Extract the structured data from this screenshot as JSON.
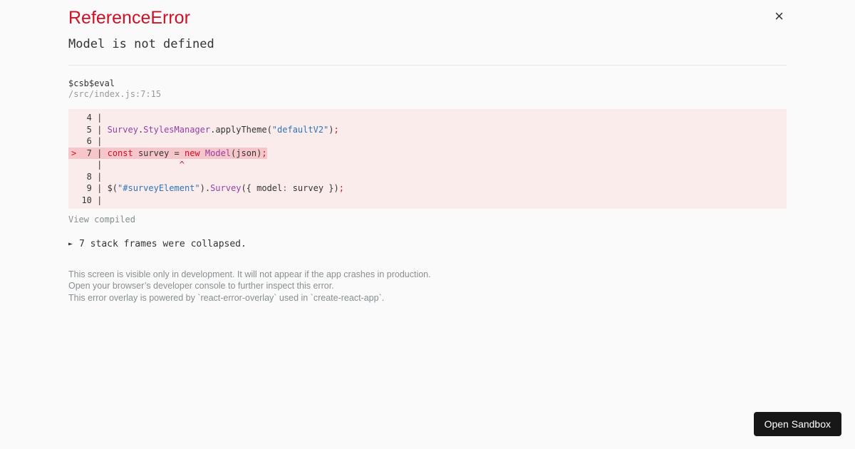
{
  "header": {
    "title": "ReferenceError",
    "subtitle": "Model is not defined",
    "close_icon": "×"
  },
  "frame": {
    "function_name": "$csb$eval",
    "location": "/src/index.js:7:15",
    "view_toggle": "View compiled"
  },
  "code_frame": {
    "background": "#fbecec",
    "highlight_background": "#f6c6cb",
    "palette": {
      "plain": "#333333",
      "red": "#ce1126",
      "class": "#9440a4",
      "string": "#2d74b8"
    },
    "lines": [
      {
        "highlight": false,
        "tokens": [
          {
            "t": "   4 | ",
            "c": "plain"
          }
        ]
      },
      {
        "highlight": false,
        "tokens": [
          {
            "t": "   5 | ",
            "c": "plain"
          },
          {
            "t": "Survey",
            "c": "class"
          },
          {
            "t": ".",
            "c": "plain"
          },
          {
            "t": "StylesManager",
            "c": "class"
          },
          {
            "t": ".applyTheme(",
            "c": "plain"
          },
          {
            "t": "\"defaultV2\"",
            "c": "string"
          },
          {
            "t": ")",
            "c": "plain"
          },
          {
            "t": ";",
            "c": "red"
          }
        ]
      },
      {
        "highlight": false,
        "tokens": [
          {
            "t": "   6 | ",
            "c": "plain"
          }
        ]
      },
      {
        "highlight": true,
        "tokens": [
          {
            "t": ">",
            "c": "red"
          },
          {
            "t": "  7 | ",
            "c": "plain"
          },
          {
            "t": "const",
            "c": "red"
          },
          {
            "t": " survey = ",
            "c": "plain"
          },
          {
            "t": "new",
            "c": "red"
          },
          {
            "t": " ",
            "c": "plain"
          },
          {
            "t": "Model",
            "c": "class"
          },
          {
            "t": "(json)",
            "c": "plain"
          },
          {
            "t": ";",
            "c": "red"
          }
        ]
      },
      {
        "highlight": false,
        "tokens": [
          {
            "t": "     | ",
            "c": "plain"
          },
          {
            "t": "              ^",
            "c": "red"
          }
        ]
      },
      {
        "highlight": false,
        "tokens": [
          {
            "t": "   8 | ",
            "c": "plain"
          }
        ]
      },
      {
        "highlight": false,
        "tokens": [
          {
            "t": "   9 | ",
            "c": "plain"
          },
          {
            "t": "$(",
            "c": "plain"
          },
          {
            "t": "\"#surveyElement\"",
            "c": "string"
          },
          {
            "t": ").",
            "c": "plain"
          },
          {
            "t": "Survey",
            "c": "class"
          },
          {
            "t": "({ model",
            "c": "plain"
          },
          {
            "t": ":",
            "c": "class"
          },
          {
            "t": " survey })",
            "c": "plain"
          },
          {
            "t": ";",
            "c": "red"
          }
        ]
      },
      {
        "highlight": false,
        "tokens": [
          {
            "t": "  10 | ",
            "c": "plain"
          }
        ]
      }
    ]
  },
  "stack": {
    "icon": "►",
    "label": "7 stack frames were collapsed."
  },
  "footer": {
    "lines": [
      "This screen is visible only in development. It will not appear if the app crashes in production.",
      "Open your browser’s developer console to further inspect this error.",
      "This error overlay is powered by `react-error-overlay` used in `create-react-app`."
    ]
  },
  "sandbox": {
    "label": "Open Sandbox",
    "background": "#171717"
  }
}
